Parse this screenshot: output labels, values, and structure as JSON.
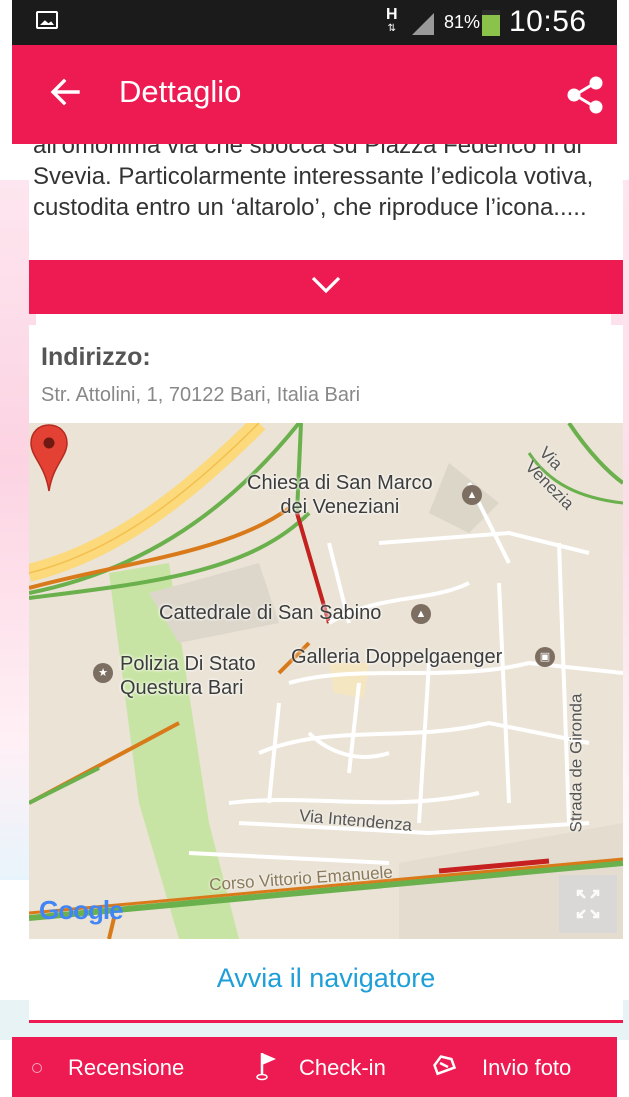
{
  "status_bar": {
    "h_indicator": "H",
    "battery_percent": "81%",
    "battery_level": 0.81,
    "time": "10:56"
  },
  "app_bar": {
    "title": "Dettaglio",
    "back_icon": "arrow-back-icon",
    "share_icon": "share-icon"
  },
  "description": {
    "text": "all'omonima via che sbocca su Piazza Federico II di Svevia. Particolarmente interessante l’edicola votiva, custodita entro un ‘altarolo’, che riproduce l’icona.....",
    "expand_icon": "chevron-down-icon"
  },
  "address": {
    "label": "Indirizzo:",
    "value": "Str. Attolini, 1, 70122 Bari, Italia   Bari"
  },
  "map": {
    "places": {
      "san_marco": "Chiesa di San Marco\ndei Veneziani",
      "cattedrale": "Cattedrale di San Sabino",
      "polizia": "Polizia Di Stato\nQuestura Bari",
      "galleria": "Galleria Doppelgaenger"
    },
    "streets": {
      "via_venezia": "Via Venezia",
      "via_intendenza": "Via Intendenza",
      "strada_gironda": "Strada de Gironda",
      "corso": "Corso Vittorio Emanuele"
    },
    "logo": "Google"
  },
  "navigator_button": "Avvia il navigatore",
  "bottom_bar": {
    "review": "Recensione",
    "checkin": "Check-in",
    "photo": "Invio foto"
  },
  "colors": {
    "accent": "#ed1b52",
    "link": "#1e9fd8"
  }
}
